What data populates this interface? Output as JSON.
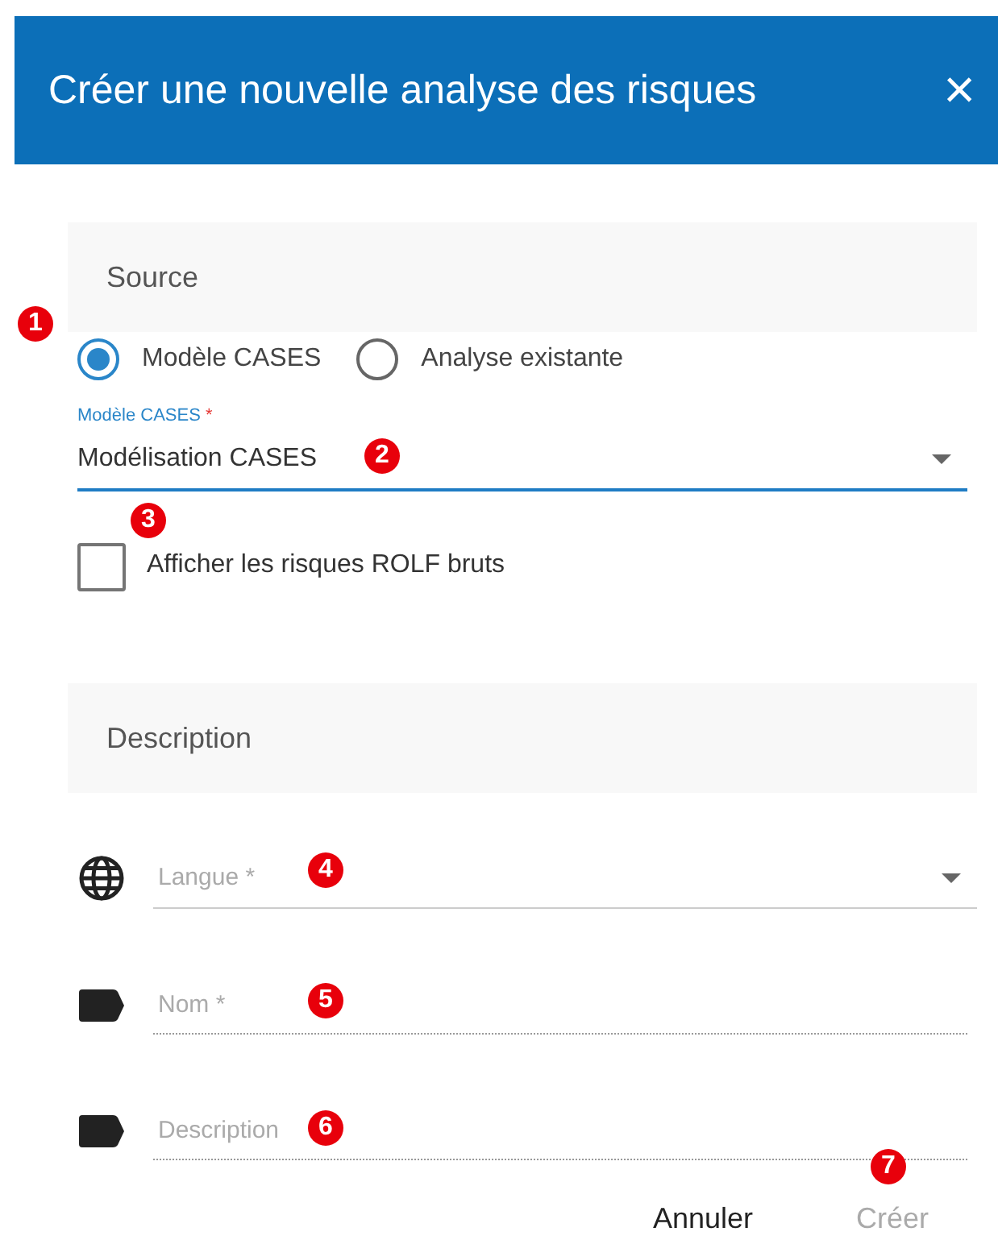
{
  "dialog": {
    "title": "Créer une nouvelle analyse des risques",
    "close": "×"
  },
  "source_section": {
    "title": "Source",
    "source_options": [
      {
        "label": "Modèle CASES",
        "selected": true
      },
      {
        "label": "Analyse existante",
        "selected": false
      }
    ],
    "model_select": {
      "label": "Modèle CASES",
      "required_mark": "*",
      "value": "Modélisation CASES"
    },
    "raw_risks_checkbox": {
      "label": "Afficher les risques ROLF bruts",
      "checked": false
    }
  },
  "description_section": {
    "title": "Description",
    "fields": [
      {
        "kind": "select",
        "placeholder": "Langue *"
      },
      {
        "kind": "text",
        "placeholder": "Nom *"
      },
      {
        "kind": "text",
        "placeholder": "Description"
      }
    ]
  },
  "buttons": [
    {
      "label": "Annuler",
      "disabled": false
    },
    {
      "label": "Créer",
      "disabled": true
    }
  ],
  "callouts": [
    {
      "number": "1"
    },
    {
      "number": "2"
    },
    {
      "number": "3"
    },
    {
      "number": "4"
    },
    {
      "number": "5"
    },
    {
      "number": "6"
    },
    {
      "number": "7"
    }
  ]
}
